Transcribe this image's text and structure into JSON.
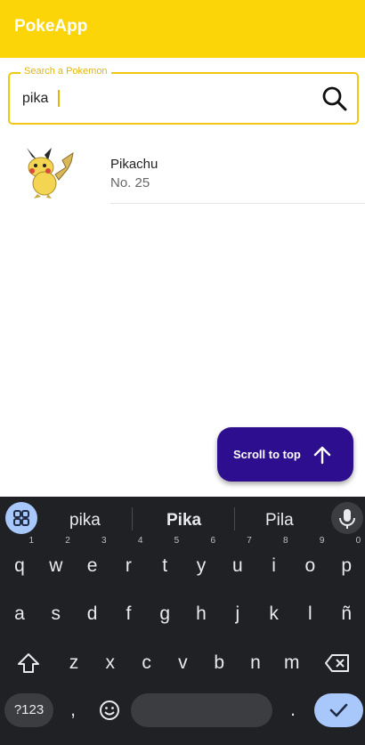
{
  "app": {
    "title": "PokeApp"
  },
  "search": {
    "label": "Search a Pokemon",
    "value": "pika"
  },
  "results": [
    {
      "name": "Pikachu",
      "number": "No. 25"
    }
  ],
  "fab": {
    "label": "Scroll to top"
  },
  "keyboard": {
    "suggestions": [
      "pika",
      "Pika",
      "Pila"
    ],
    "row1": [
      {
        "k": "q",
        "h": "1"
      },
      {
        "k": "w",
        "h": "2"
      },
      {
        "k": "e",
        "h": "3"
      },
      {
        "k": "r",
        "h": "4"
      },
      {
        "k": "t",
        "h": "5"
      },
      {
        "k": "y",
        "h": "6"
      },
      {
        "k": "u",
        "h": "7"
      },
      {
        "k": "i",
        "h": "8"
      },
      {
        "k": "o",
        "h": "9"
      },
      {
        "k": "p",
        "h": "0"
      }
    ],
    "row2": [
      "a",
      "s",
      "d",
      "f",
      "g",
      "h",
      "j",
      "k",
      "l",
      "ñ"
    ],
    "row3": [
      "z",
      "x",
      "c",
      "v",
      "b",
      "n",
      "m"
    ],
    "symbols_label": "?123",
    "comma": ",",
    "period": "."
  },
  "colors": {
    "appbar": "#fcd508",
    "fab": "#2d0e8e",
    "accent": "#a8c7fa",
    "keyboard": "#202124"
  }
}
